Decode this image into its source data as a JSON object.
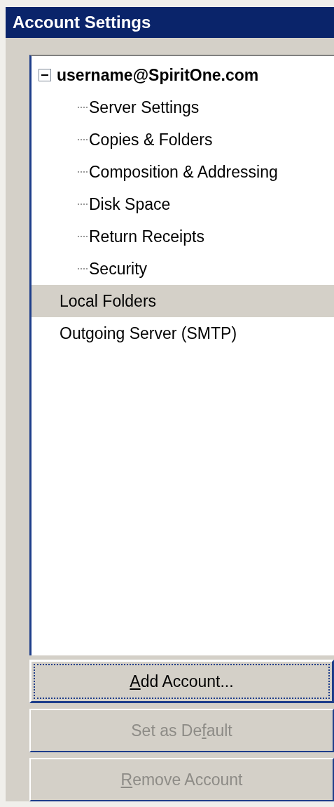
{
  "panel": {
    "title": "Account Settings"
  },
  "tree": [
    {
      "label": "username@SpiritOne.com",
      "kind": "account",
      "expanded": true,
      "selected": false,
      "children": [
        {
          "label": "Server Settings",
          "selected": false
        },
        {
          "label": "Copies & Folders",
          "selected": false
        },
        {
          "label": "Composition & Addressing",
          "selected": false
        },
        {
          "label": "Disk Space",
          "selected": false
        },
        {
          "label": "Return Receipts",
          "selected": false
        },
        {
          "label": "Security",
          "selected": false
        }
      ]
    },
    {
      "label": "Local Folders",
      "kind": "folders",
      "selected": true
    },
    {
      "label": "Outgoing Server (SMTP)",
      "kind": "server",
      "selected": false
    }
  ],
  "buttons": [
    {
      "label": {
        "key": "A",
        "post": "dd Account..."
      },
      "focused": true,
      "disabled": false
    },
    {
      "label": {
        "pre": "Set as De",
        "key": "f",
        "post": "ault"
      },
      "focused": false,
      "disabled": true
    },
    {
      "label": {
        "key": "R",
        "post": "emove Account"
      },
      "focused": false,
      "disabled": true
    }
  ]
}
